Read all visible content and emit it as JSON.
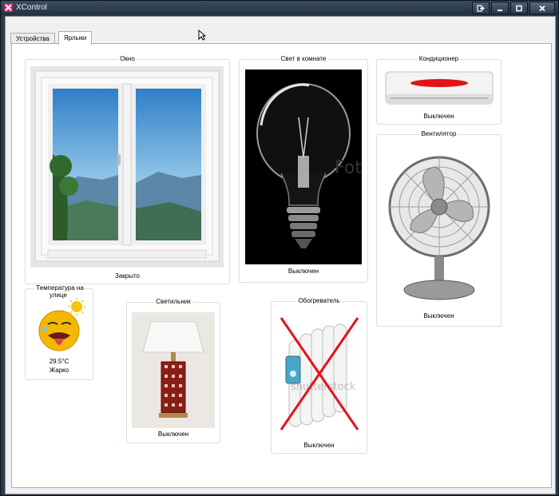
{
  "window": {
    "title": "XControl"
  },
  "tabs": [
    {
      "label": "Устройства",
      "active": false
    },
    {
      "label": "Ярлыки",
      "active": true
    }
  ],
  "devices": {
    "window": {
      "title": "Окно",
      "status": "Закрыто"
    },
    "light": {
      "title": "Свет в комнате",
      "status": "Выключен"
    },
    "ac": {
      "title": "Кондиционер",
      "status": "Выключен"
    },
    "fan": {
      "title": "Вентилятор",
      "status": "Выключен"
    },
    "temperature": {
      "title": "Температура на улице",
      "value": "29.5°C",
      "status": "Жарко"
    },
    "lamp": {
      "title": "Светильник",
      "status": "Выключен"
    },
    "heater": {
      "title": "Обогреватель",
      "status": "Выключен"
    }
  },
  "watermarks": {
    "light": "Fotolia",
    "heater": "shutterstock"
  },
  "icons": [
    "app-icon",
    "exit-icon",
    "minimize-icon",
    "maximize-icon",
    "close-icon",
    "mouse-cursor-icon"
  ],
  "colors": {
    "titlebar": "#2b3a4a",
    "accent_red": "#e0141a"
  }
}
